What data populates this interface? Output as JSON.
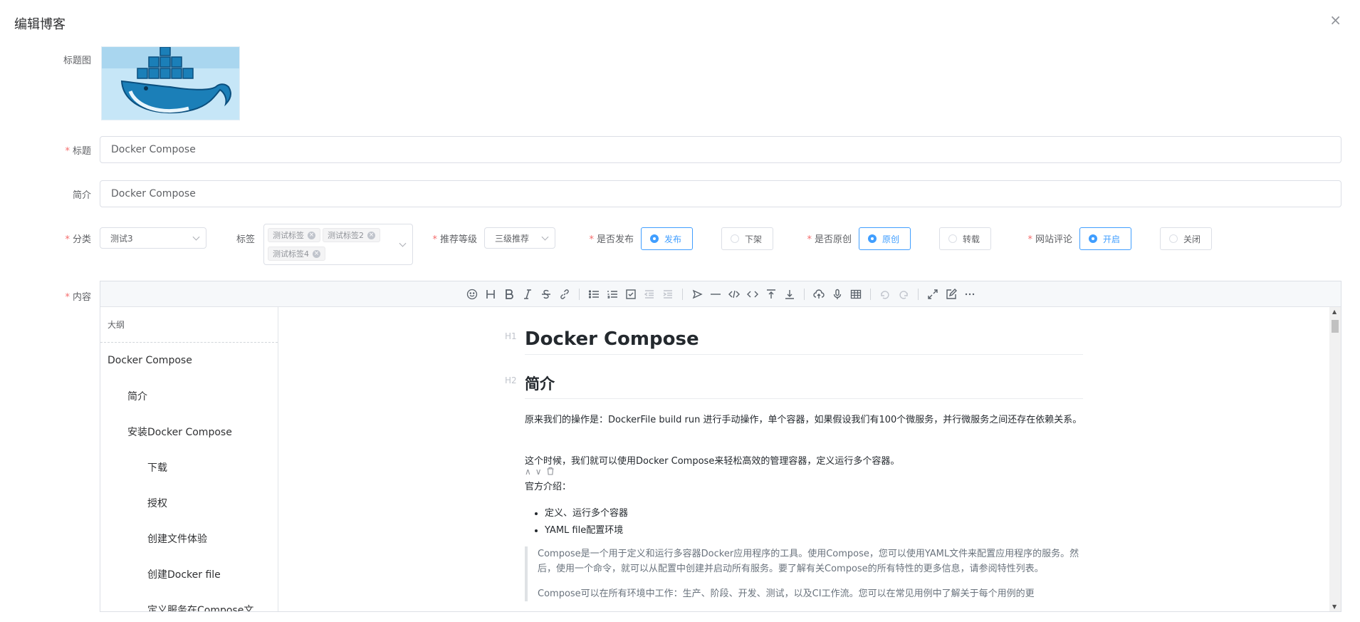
{
  "dialog": {
    "title": "编辑博客",
    "close_icon": "×"
  },
  "form": {
    "cover_label": "标题图",
    "title_label": "标题",
    "title_value": "Docker Compose",
    "summary_label": "简介",
    "summary_value": "Docker Compose",
    "category_label": "分类",
    "category_value": "测试3",
    "tags_label": "标签",
    "tags": [
      "测试标签",
      "测试标签2",
      "测试标签4"
    ],
    "level_label": "推荐等级",
    "level_value": "三级推荐",
    "publish_label": "是否发布",
    "publish_options": [
      "发布",
      "下架"
    ],
    "original_label": "是否原创",
    "original_options": [
      "原创",
      "转载"
    ],
    "comment_label": "网站评论",
    "comment_options": [
      "开启",
      "关闭"
    ],
    "content_label": "内容",
    "required_mark": "*"
  },
  "editor": {
    "outline_title": "大纲",
    "outline": [
      "Docker Compose",
      "简介",
      "安装Docker Compose",
      "下载",
      "授权",
      "创建文件体验",
      "创建Docker file",
      "定义服务在Compose文"
    ],
    "doc": {
      "h1_mark": "H1",
      "h1": "Docker Compose",
      "h2_mark": "H2",
      "h2": "简介",
      "p1": "原来我们的操作是：DockerFile build run 进行手动操作，单个容器，如果假设我们有100个微服务，并行微服务之间还存在依赖关系。",
      "p2": "这个时候，我们就可以使用Docker Compose来轻松高效的管理容器，定义运行多个容器。",
      "p3": "官方介绍：",
      "list": [
        "定义、运行多个容器",
        "YAML file配置环境"
      ],
      "quote": "Compose是一个用于定义和运行多容器Docker应用程序的工具。使用Compose，您可以使用YAML文件来配置应用程序的服务。然后，使用一个命令，就可以从配置中创建并启动所有服务。要了解有关Compose的所有特性的更多信息，请参阅特性列表。",
      "quote2": "Compose可以在所有环境中工作：生产、阶段、开发、测试，以及CI工作流。您可以在常见用例中了解关于每个用例的更"
    }
  },
  "colors": {
    "accent": "#409eff",
    "required": "#f56c6c"
  }
}
